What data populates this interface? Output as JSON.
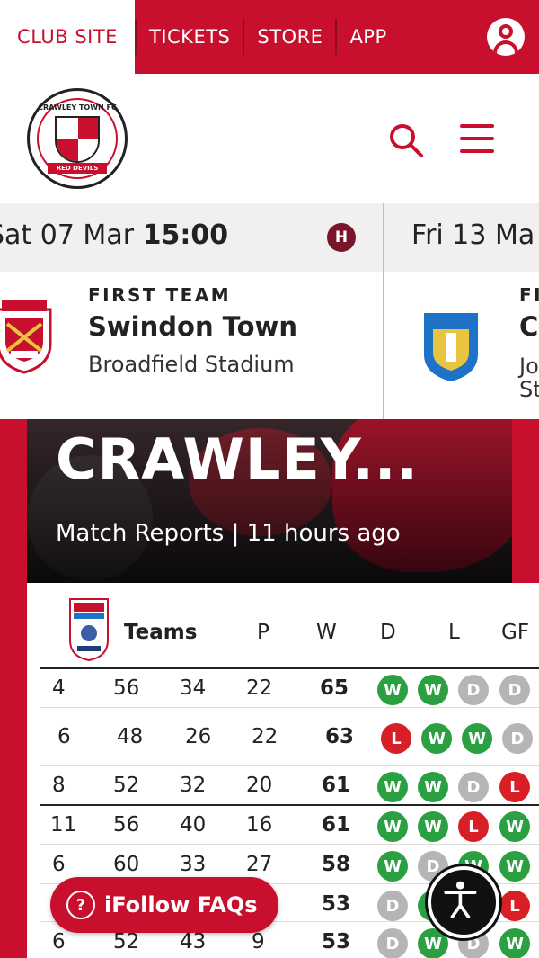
{
  "topnav": {
    "club_site": "CLUB SITE",
    "tickets": "TICKETS",
    "store": "STORE",
    "app": "APP"
  },
  "crest": {
    "top_text": "CRAWLEY TOWN FC",
    "banner_text": "RED DEVILS"
  },
  "fixtures": [
    {
      "date": "Sat 07 Mar",
      "time": "15:00",
      "badge": "H",
      "label": "FIRST TEAM",
      "opponent": "Swindon Town",
      "venue": "Broadfield Stadium"
    },
    {
      "date": "Fri 13 Ma",
      "label": "FI",
      "opponent": "C",
      "venue_line1": "Jo",
      "venue_line2": "St"
    }
  ],
  "hero": {
    "title": "CRAWLEY...",
    "meta": "Match Reports | 11 hours ago"
  },
  "table": {
    "logo_text": "sky bet LEAGUE TWO EFL",
    "headers": {
      "teams": "Teams",
      "p": "P",
      "w": "W",
      "d": "D",
      "l": "L",
      "gf": "GF"
    },
    "rows": [
      {
        "c1": "4",
        "c2": "56",
        "c3": "34",
        "c4": "22",
        "pts": "65",
        "form": [
          "W",
          "W",
          "D",
          "D"
        ]
      },
      {
        "c1": "6",
        "c2": "48",
        "c3": "26",
        "c4": "22",
        "pts": "63",
        "form": [
          "L",
          "W",
          "W",
          "D"
        ]
      },
      {
        "c1": "8",
        "c2": "52",
        "c3": "32",
        "c4": "20",
        "pts": "61",
        "form": [
          "W",
          "W",
          "D",
          "L"
        ]
      },
      {
        "c1": "11",
        "c2": "56",
        "c3": "40",
        "c4": "16",
        "pts": "61",
        "form": [
          "W",
          "W",
          "L",
          "W"
        ]
      },
      {
        "c1": "6",
        "c2": "60",
        "c3": "33",
        "c4": "27",
        "pts": "58",
        "form": [
          "W",
          "D",
          "W",
          "W"
        ]
      },
      {
        "c1": "",
        "c2": "",
        "c3": "",
        "c4": "",
        "pts": "53",
        "form": [
          "D",
          "W",
          "",
          "L"
        ]
      },
      {
        "c1": "6",
        "c2": "52",
        "c3": "43",
        "c4": "9",
        "pts": "53",
        "form": [
          "D",
          "W",
          "D",
          "W"
        ]
      }
    ]
  },
  "floating": {
    "faq_label": "iFollow FAQs",
    "faq_icon": "?"
  },
  "colors": {
    "brand_red": "#c8102e",
    "win": "#2aa042",
    "draw": "#b5b5b5",
    "loss": "#d81f26"
  },
  "icons": [
    "user-icon",
    "search-icon",
    "menu-icon",
    "question-icon",
    "accessibility-icon"
  ]
}
